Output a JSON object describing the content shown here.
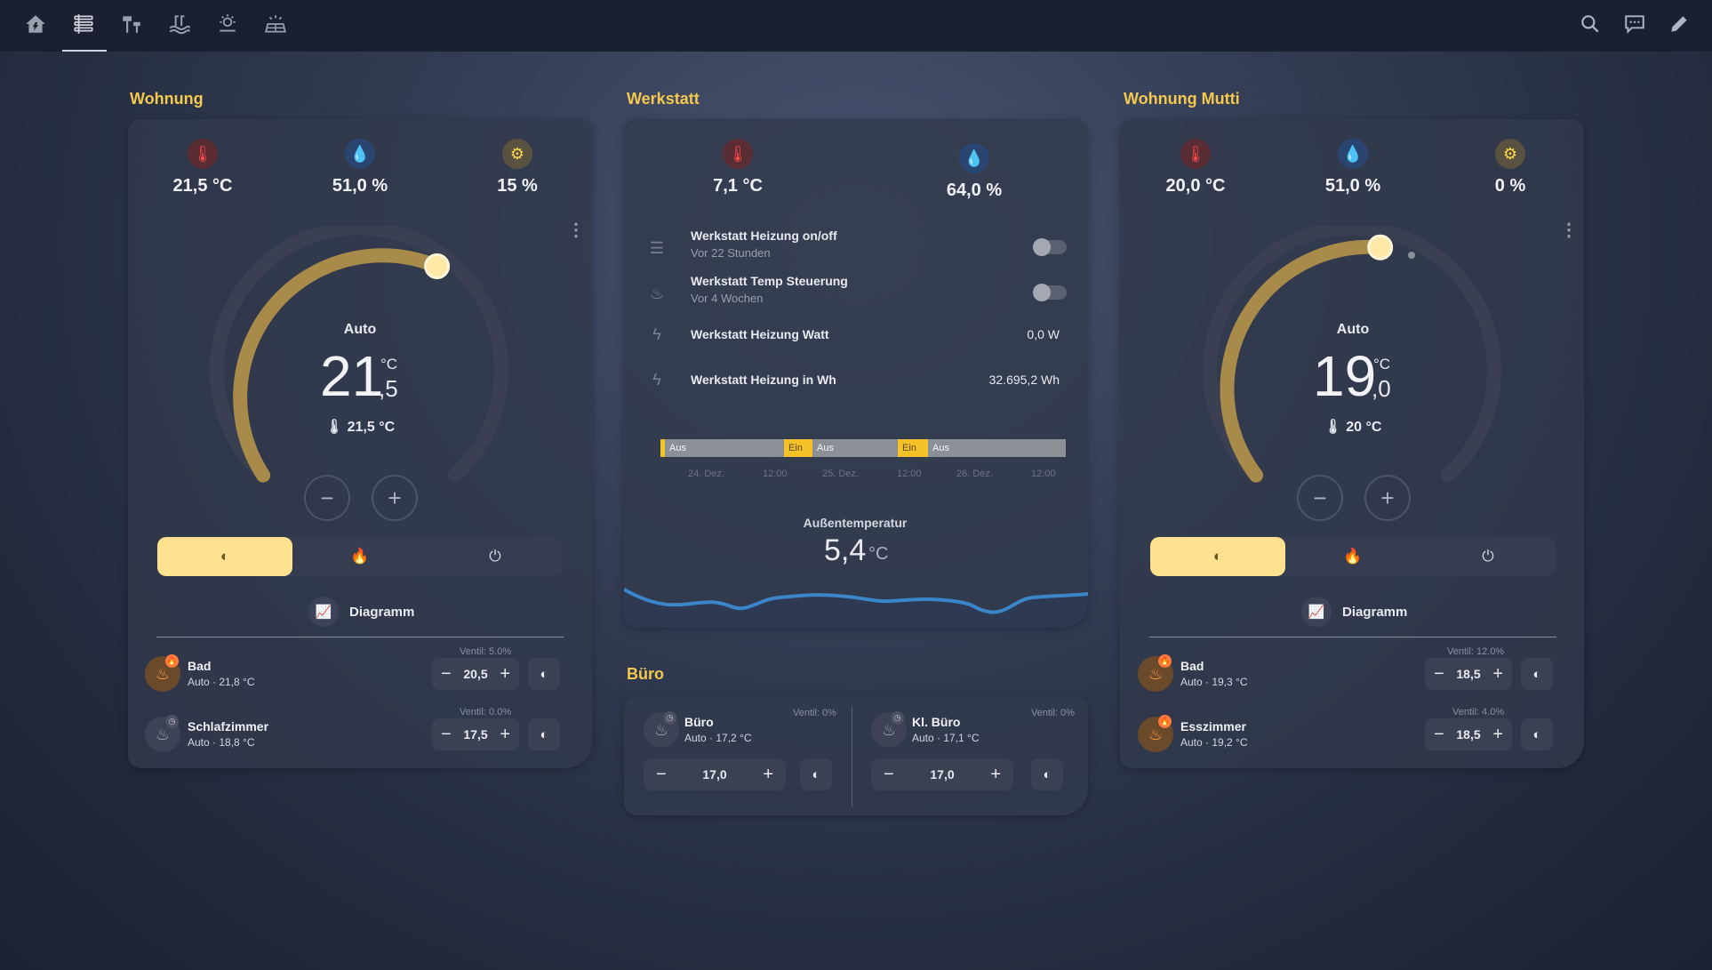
{
  "nav": {
    "icons": [
      "home-icon",
      "heating-icon",
      "garden-lamp-icon",
      "pool-icon",
      "weather-icon",
      "solar-icon"
    ],
    "right_icons": [
      "search-icon",
      "chat-icon",
      "edit-icon"
    ]
  },
  "wohnung": {
    "title": "Wohnung",
    "stats": [
      {
        "icon": "thermometer-icon",
        "value": "21,5 °C"
      },
      {
        "icon": "water-icon",
        "value": "51,0 %"
      },
      {
        "icon": "valve-icon",
        "value": "15 %"
      }
    ],
    "thermostat": {
      "mode": "Auto",
      "target_int": "21",
      "target_dec": ",5",
      "unit": "°C",
      "current": "21,5 °C",
      "target": 21.5
    },
    "diagram_label": "Diagramm",
    "rooms": [
      {
        "name": "Bad",
        "sub": "Auto · 21,8 °C",
        "ventil": "Ventil: 5.0%",
        "value": "20,5",
        "state": "heat"
      },
      {
        "name": "Schlafzimmer",
        "sub": "Auto · 18,8 °C",
        "ventil": "Ventil: 0.0%",
        "value": "17,5",
        "state": "idle"
      }
    ]
  },
  "werkstatt": {
    "title": "Werkstatt",
    "stats": [
      {
        "icon": "thermometer-icon",
        "value": "7,1 °C"
      },
      {
        "icon": "water-icon",
        "value": "64,0 %"
      }
    ],
    "entities": [
      {
        "name": "Werkstatt Heizung on/off",
        "sub": "Vor 22 Stunden",
        "type": "toggle"
      },
      {
        "name": "Werkstatt Temp Steuerung",
        "sub": "Vor 4 Wochen",
        "type": "toggle"
      },
      {
        "name": "Werkstatt Heizung Watt",
        "value": "0,0 W",
        "type": "value"
      },
      {
        "name": "Werkstatt Heizung in Wh",
        "value": "32.695,2 Wh",
        "type": "value"
      }
    ],
    "timeline": {
      "segments": [
        {
          "label": "Aus",
          "state": "off"
        },
        {
          "label": "Ein",
          "state": "on"
        },
        {
          "label": "Aus",
          "state": "off"
        },
        {
          "label": "Ein",
          "state": "on"
        },
        {
          "label": "Aus",
          "state": "off"
        }
      ],
      "ticks": [
        "24. Dez.",
        "12:00",
        "25. Dez.",
        "12:00",
        "26. Dez.",
        "12:00"
      ]
    },
    "outside": {
      "label": "Außentemperatur",
      "value": "5,4",
      "unit": "°C"
    }
  },
  "buero": {
    "title": "Büro",
    "rooms": [
      {
        "name": "Büro",
        "sub": "Auto · 17,2 °C",
        "ventil": "Ventil: 0%",
        "value": "17,0"
      },
      {
        "name": "Kl. Büro",
        "sub": "Auto · 17,1 °C",
        "ventil": "Ventil: 0%",
        "value": "17,0"
      }
    ]
  },
  "mutti": {
    "title": "Wohnung Mutti",
    "stats": [
      {
        "icon": "thermometer-icon",
        "value": "20,0 °C"
      },
      {
        "icon": "water-icon",
        "value": "51,0 %"
      },
      {
        "icon": "valve-icon",
        "value": "0 %"
      }
    ],
    "thermostat": {
      "mode": "Auto",
      "target_int": "19",
      "target_dec": ",0",
      "unit": "°C",
      "current": "20 °C",
      "target": 19.0
    },
    "diagram_label": "Diagramm",
    "rooms": [
      {
        "name": "Bad",
        "sub": "Auto · 19,3 °C",
        "ventil": "Ventil: 12.0%",
        "value": "18,5",
        "state": "heat"
      },
      {
        "name": "Esszimmer",
        "sub": "Auto · 19,2 °C",
        "ventil": "Ventil: 4.0%",
        "value": "18,5",
        "state": "heat"
      }
    ]
  },
  "colors": {
    "accent": "#f4c94e",
    "arc": "#a88a4a",
    "active_mode": "#ffe28f",
    "timeline_on": "#f4c227",
    "line": "#3a86c8"
  }
}
